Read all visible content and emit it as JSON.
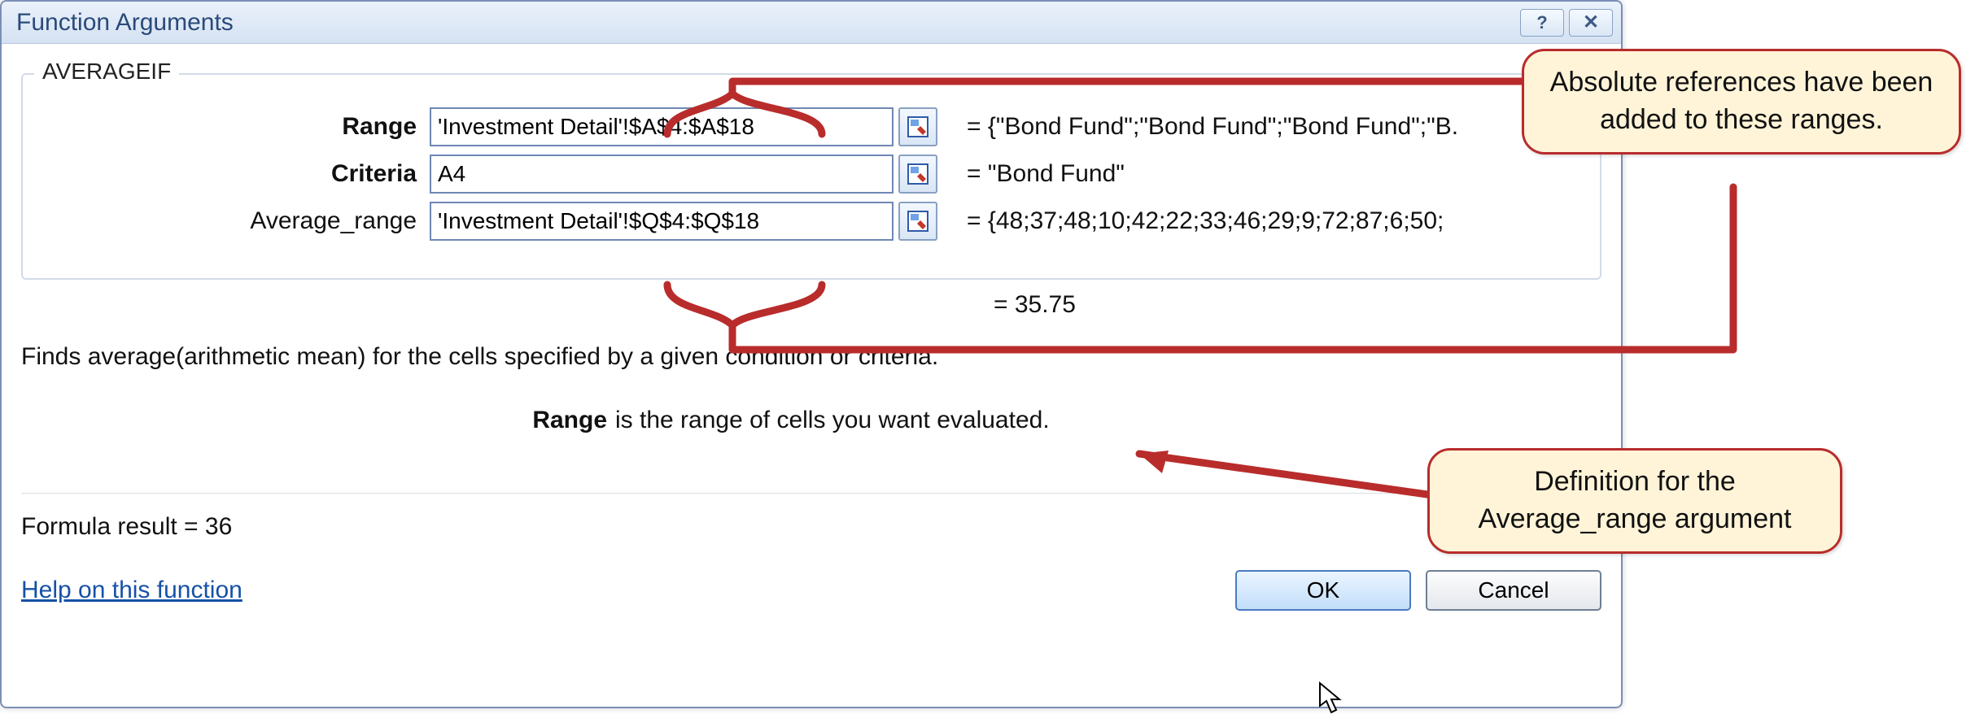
{
  "dialog": {
    "title": "Function Arguments",
    "function_name": "AVERAGEIF",
    "help_button": "?",
    "close_button": "✕"
  },
  "args": {
    "range_label": "Range",
    "range_value": "'Investment Detail'!$A$4:$A$18",
    "range_result": "=   {\"Bond Fund\";\"Bond Fund\";\"Bond Fund\";\"B.",
    "criteria_label": "Criteria",
    "criteria_value": "A4",
    "criteria_result": "=   \"Bond Fund\"",
    "avgrange_label": "Average_range",
    "avgrange_value": "'Investment Detail'!$Q$4:$Q$18",
    "avgrange_result": "=   {48;37;48;10;42;22;33;46;29;9;72;87;6;50;",
    "overall_result": "=   35.75"
  },
  "desc": "Finds average(arithmetic mean) for the cells specified by a given condition or criteria.",
  "hint": {
    "label": "Range",
    "text": "is the range of cells you want evaluated."
  },
  "footer": {
    "formula_result_label": "Formula result  =   ",
    "formula_result_value": "36",
    "help_link": "Help on this function",
    "ok": "OK",
    "cancel": "Cancel"
  },
  "callouts": {
    "c1": "Absolute references have been added to these ranges.",
    "c2": "Definition for the Average_range argument"
  }
}
